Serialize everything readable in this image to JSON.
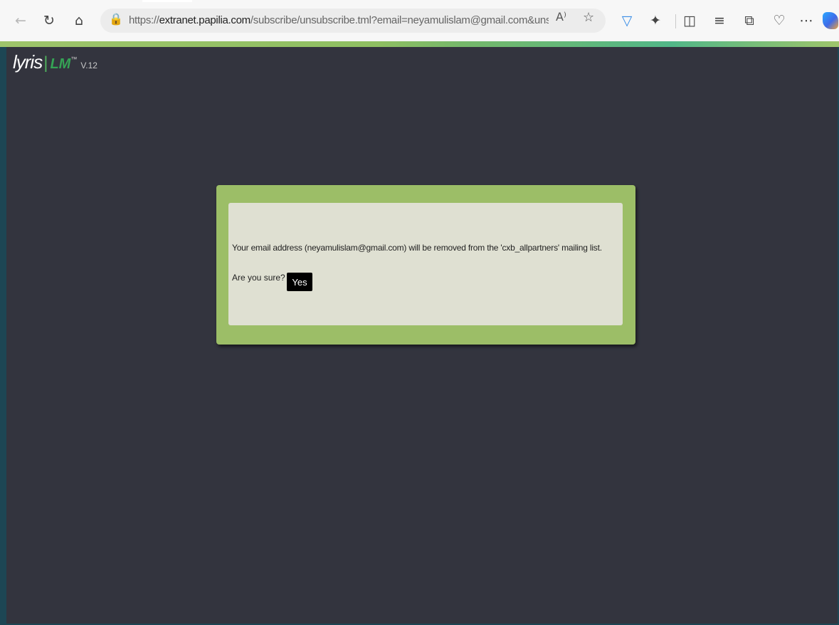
{
  "browser": {
    "url_scheme": "https://",
    "url_host": "extranet.papilia.com",
    "url_path": "/subscribe/unsubscribe.tml?email=neyamulislam@gmail.com&unsubscrib...",
    "icons": {
      "back": "←",
      "refresh": "↻",
      "home": "⌂",
      "lock": "🔒",
      "read_aloud": "A⁾",
      "favorite": "☆",
      "shield": "▽",
      "extensions": "✦",
      "split": "◫",
      "favorites_list": "≡",
      "collections": "⧉",
      "health": "♡",
      "more": "⋯"
    }
  },
  "app": {
    "logo_text": "lyris",
    "logo_divider": "|",
    "logo_product": "LM",
    "logo_tm": "™",
    "logo_version": "V.12"
  },
  "dialog": {
    "message": "Your email address (neyamulislam@gmail.com) will be removed from the 'cxb_allpartners' mailing list.",
    "confirm_text": "Are you sure?",
    "yes_label": "Yes"
  }
}
